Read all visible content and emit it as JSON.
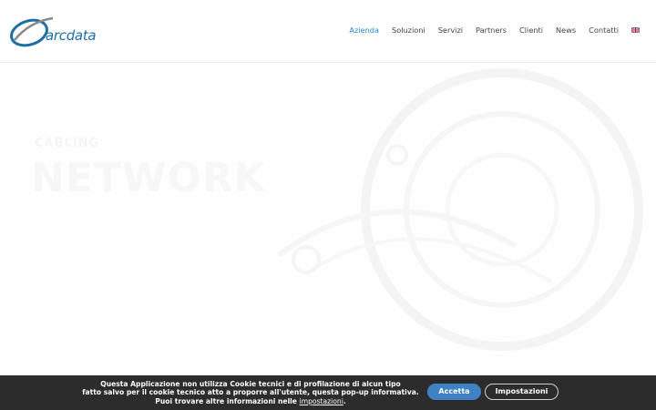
{
  "brand": {
    "logo_text": "arcdata"
  },
  "nav": {
    "items": [
      {
        "label": "Azienda",
        "active": true
      },
      {
        "label": "Soluzioni",
        "active": false
      },
      {
        "label": "Servizi",
        "active": false
      },
      {
        "label": "Partners",
        "active": false
      },
      {
        "label": "Clienti",
        "active": false
      },
      {
        "label": "News",
        "active": false
      },
      {
        "label": "Contatti",
        "active": false
      }
    ],
    "language_flag": "uk-flag-icon"
  },
  "hero": {
    "subtitle": "CABLING",
    "title": "NETWORK"
  },
  "cookie_banner": {
    "line1": "Questa Applicazione non utilizza Cookie tecnici e di profilazione di alcun tipo",
    "line2": "fatto salvo per il cookie tecnico atto a proporre all'utente, questa pop-up informativa.",
    "line3_prefix": "Puoi trovare altre informazioni nelle",
    "link_label": "impostazioni",
    "line3_suffix": ".",
    "accept_label": "Accetta",
    "settings_label": "Impostazioni"
  },
  "colors": {
    "accent": "#2f86c6",
    "logo_blue": "#1f6fa6",
    "cookie_bar": "#2c2c2c",
    "accept_button": "#3f82c4"
  }
}
